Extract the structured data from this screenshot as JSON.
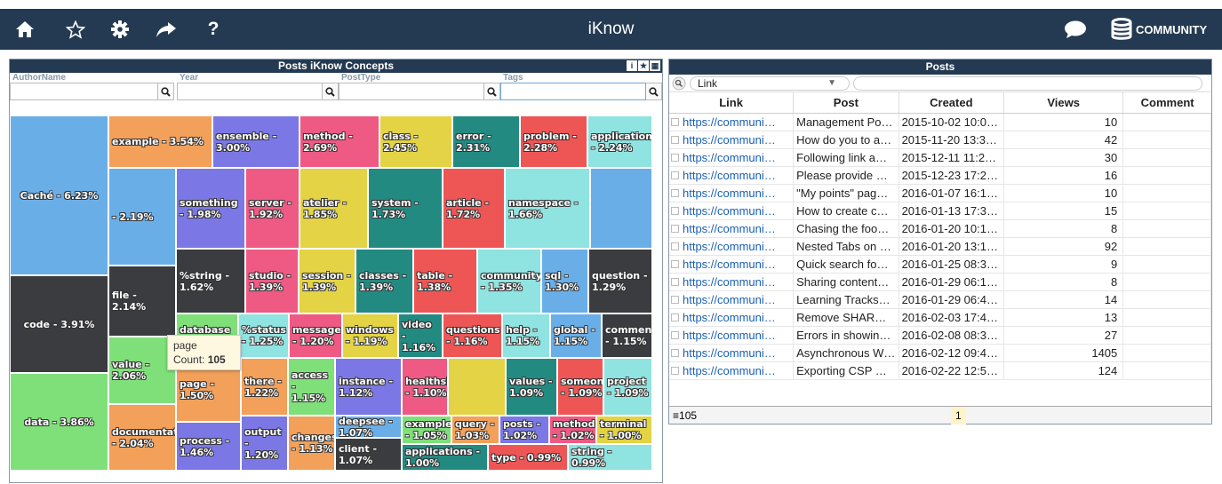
{
  "app": {
    "title": "iKnow",
    "community_label": "COMMUNITY"
  },
  "toolbar": {
    "icons": [
      "home-icon",
      "star-icon",
      "gear-icon",
      "share-icon",
      "help-icon"
    ]
  },
  "left_panel": {
    "title": "Posts iKnow Concepts",
    "tools": [
      "i",
      "★",
      "▦"
    ],
    "filters": [
      {
        "label": "AuthorName",
        "value": ""
      },
      {
        "label": "Year",
        "value": ""
      },
      {
        "label": "PostType",
        "value": ""
      },
      {
        "label": "Tags",
        "value": ""
      }
    ],
    "tooltip": {
      "line1": "page",
      "count_label": "Count: ",
      "count_value": "105"
    }
  },
  "chart_data": {
    "type": "treemap",
    "title": "Posts iKnow Concepts",
    "items": [
      {
        "label": "Caché - 6.23%",
        "name": "Caché",
        "value": 6.23,
        "color": "#6aaee8"
      },
      {
        "label": "code - 3.91%",
        "name": "code",
        "value": 3.91,
        "color": "#3a3c40"
      },
      {
        "label": "data - 3.86%",
        "name": "data",
        "value": 3.86,
        "color": "#7fe07a"
      },
      {
        "label": "example - 3.54%",
        "name": "example",
        "value": 3.54,
        "color": "#f2a05a"
      },
      {
        "label": "ensemble - 3.00%",
        "name": "ensemble",
        "value": 3.0,
        "color": "#7b78e6"
      },
      {
        "label": "method - 2.69%",
        "name": "method",
        "value": 2.69,
        "color": "#ee5a84"
      },
      {
        "label": "class - 2.45%",
        "name": "class",
        "value": 2.45,
        "color": "#e3d345"
      },
      {
        "label": "error - 2.31%",
        "name": "error",
        "value": 2.31,
        "color": "#238a82"
      },
      {
        "label": "problem - 2.28%",
        "name": "problem",
        "value": 2.28,
        "color": "#ee5656"
      },
      {
        "label": "application - 2.24%",
        "name": "application",
        "value": 2.24,
        "color": "#8fe3e0"
      },
      {
        "label": "- 2.19%",
        "name": "",
        "value": 2.19,
        "color": "#6aaee8"
      },
      {
        "label": "file - 2.14%",
        "name": "file",
        "value": 2.14,
        "color": "#3a3c40"
      },
      {
        "label": "value - 2.06%",
        "name": "value",
        "value": 2.06,
        "color": "#7fe07a"
      },
      {
        "label": "documentation - 2.04%",
        "name": "documentation",
        "value": 2.04,
        "color": "#f2a05a"
      },
      {
        "label": "something - 1.98%",
        "name": "something",
        "value": 1.98,
        "color": "#7b78e6"
      },
      {
        "label": "server - 1.92%",
        "name": "server",
        "value": 1.92,
        "color": "#ee5a84"
      },
      {
        "label": "atelier - 1.85%",
        "name": "atelier",
        "value": 1.85,
        "color": "#e3d345"
      },
      {
        "label": "system - 1.73%",
        "name": "system",
        "value": 1.73,
        "color": "#238a82"
      },
      {
        "label": "article - 1.72%",
        "name": "article",
        "value": 1.72,
        "color": "#ee5656"
      },
      {
        "label": "namespace - 1.66%",
        "name": "namespace",
        "value": 1.66,
        "color": "#8fe3e0"
      },
      {
        "label": "",
        "name": "",
        "value": null,
        "color": "#6aaee8"
      },
      {
        "label": "%string - 1.62%",
        "name": "%string",
        "value": 1.62,
        "color": "#3a3c40"
      },
      {
        "label": "studio - 1.39%",
        "name": "studio",
        "value": 1.39,
        "color": "#ee5a84"
      },
      {
        "label": "session - 1.39%",
        "name": "session",
        "value": 1.39,
        "color": "#e3d345"
      },
      {
        "label": "classes - 1.39%",
        "name": "classes",
        "value": 1.39,
        "color": "#238a82"
      },
      {
        "label": "table - 1.38%",
        "name": "table",
        "value": 1.38,
        "color": "#ee5656"
      },
      {
        "label": "community - 1.35%",
        "name": "community",
        "value": 1.35,
        "color": "#8fe3e0"
      },
      {
        "label": "sql - 1.30%",
        "name": "sql",
        "value": 1.3,
        "color": "#6aaee8"
      },
      {
        "label": "question - 1.29%",
        "name": "question",
        "value": 1.29,
        "color": "#3a3c40"
      },
      {
        "label": "database - 1.26%",
        "name": "database",
        "value": 1.26,
        "color": "#7fe07a"
      },
      {
        "label": "%status - 1.25%",
        "name": "%status",
        "value": 1.25,
        "color": "#8fe3e0"
      },
      {
        "label": "message - 1.20%",
        "name": "message",
        "value": 1.2,
        "color": "#ee5a84"
      },
      {
        "label": "windows - 1.19%",
        "name": "windows",
        "value": 1.19,
        "color": "#e3d345"
      },
      {
        "label": "video - 1.16%",
        "name": "video",
        "value": 1.16,
        "color": "#238a82"
      },
      {
        "label": "questions - 1.16%",
        "name": "questions",
        "value": 1.16,
        "color": "#ee5656"
      },
      {
        "label": "help - 1.15%",
        "name": "help",
        "value": 1.15,
        "color": "#8fe3e0"
      },
      {
        "label": "global - 1.15%",
        "name": "global",
        "value": 1.15,
        "color": "#6aaee8"
      },
      {
        "label": "comments - 1.15%",
        "name": "comments",
        "value": 1.15,
        "color": "#3a3c40"
      },
      {
        "label": "page - 1.50%",
        "name": "page",
        "value": 1.5,
        "color": "#f2a05a"
      },
      {
        "label": "there - 1.22%",
        "name": "there",
        "value": 1.22,
        "color": "#f2a05a"
      },
      {
        "label": "access - 1.15%",
        "name": "access",
        "value": 1.15,
        "color": "#7fe07a"
      },
      {
        "label": "instance - 1.12%",
        "name": "instance",
        "value": 1.12,
        "color": "#7b78e6"
      },
      {
        "label": "healthshare - 1.10%",
        "name": "healthshare",
        "value": 1.1,
        "color": "#ee5a84"
      },
      {
        "label": "",
        "name": "",
        "value": null,
        "color": "#e3d345"
      },
      {
        "label": "values - 1.09%",
        "name": "values",
        "value": 1.09,
        "color": "#238a82"
      },
      {
        "label": "someone - 1.09%",
        "name": "someone",
        "value": 1.09,
        "color": "#ee5656"
      },
      {
        "label": "project - 1.09%",
        "name": "project",
        "value": 1.09,
        "color": "#8fe3e0"
      },
      {
        "label": "process - 1.46%",
        "name": "process",
        "value": 1.46,
        "color": "#7b78e6"
      },
      {
        "label": "output - 1.20%",
        "name": "output",
        "value": 1.2,
        "color": "#7b78e6"
      },
      {
        "label": "changes - 1.13%",
        "name": "changes",
        "value": 1.13,
        "color": "#f2a05a"
      },
      {
        "label": "deepsee - 1.07%",
        "name": "deepsee",
        "value": 1.07,
        "color": "#6aaee8"
      },
      {
        "label": "client - 1.07%",
        "name": "client",
        "value": 1.07,
        "color": "#3a3c40"
      },
      {
        "label": "examples - 1.05%",
        "name": "examples",
        "value": 1.05,
        "color": "#7fe07a"
      },
      {
        "label": "query - 1.03%",
        "name": "query",
        "value": 1.03,
        "color": "#f2a05a"
      },
      {
        "label": "posts - 1.02%",
        "name": "posts",
        "value": 1.02,
        "color": "#7b78e6"
      },
      {
        "label": "methods - 1.02%",
        "name": "methods",
        "value": 1.02,
        "color": "#ee5a84"
      },
      {
        "label": "terminal - 1.00%",
        "name": "terminal",
        "value": 1.0,
        "color": "#e3d345"
      },
      {
        "label": "applications - 1.00%",
        "name": "applications",
        "value": 1.0,
        "color": "#238a82"
      },
      {
        "label": "type - 0.99%",
        "name": "type",
        "value": 0.99,
        "color": "#ee5656"
      },
      {
        "label": "string - 0.99%",
        "name": "string",
        "value": 0.99,
        "color": "#8fe3e0"
      }
    ]
  },
  "grid": {
    "title": "Posts",
    "filter_field": "Link",
    "filter_value": "",
    "columns": [
      "Link",
      "Post",
      "Created",
      "Views",
      "Comment"
    ],
    "rows": [
      [
        "https://communi…",
        "Management Po…",
        "2015-10-02 10:0…",
        "10",
        ""
      ],
      [
        "https://communi…",
        "How do you to a…",
        "2015-11-20 13:3…",
        "42",
        ""
      ],
      [
        "https://communi…",
        "Following link a…",
        "2015-12-11 11:2…",
        "30",
        ""
      ],
      [
        "https://communi…",
        "Please provide …",
        "2015-12-23 17:2…",
        "16",
        ""
      ],
      [
        "https://communi…",
        "\"My points\" pag…",
        "2016-01-07 16:1…",
        "10",
        ""
      ],
      [
        "https://communi…",
        "How to create c…",
        "2016-01-13 17:3…",
        "15",
        ""
      ],
      [
        "https://communi…",
        "Chasing the foo…",
        "2016-01-20 10:1…",
        "8",
        ""
      ],
      [
        "https://communi…",
        "Nested Tabs on …",
        "2016-01-20 13:1…",
        "92",
        ""
      ],
      [
        "https://communi…",
        "Quick search fo…",
        "2016-01-25 08:3…",
        "9",
        ""
      ],
      [
        "https://communi…",
        "Sharing content…",
        "2016-01-29 06:1…",
        "8",
        ""
      ],
      [
        "https://communi…",
        "Learning Tracks…",
        "2016-01-29 06:4…",
        "14",
        ""
      ],
      [
        "https://communi…",
        "Remove SHAR…",
        "2016-02-03 17:4…",
        "13",
        ""
      ],
      [
        "https://communi…",
        "Errors in showin…",
        "2016-02-08 08:3…",
        "27",
        ""
      ],
      [
        "https://communi…",
        "Asynchronous W…",
        "2016-02-12 09:4…",
        "1405",
        ""
      ],
      [
        "https://communi…",
        "Exporting CSP …",
        "2016-02-22 12:5…",
        "124",
        ""
      ]
    ],
    "footer_count": "105",
    "footer_page": "1"
  }
}
